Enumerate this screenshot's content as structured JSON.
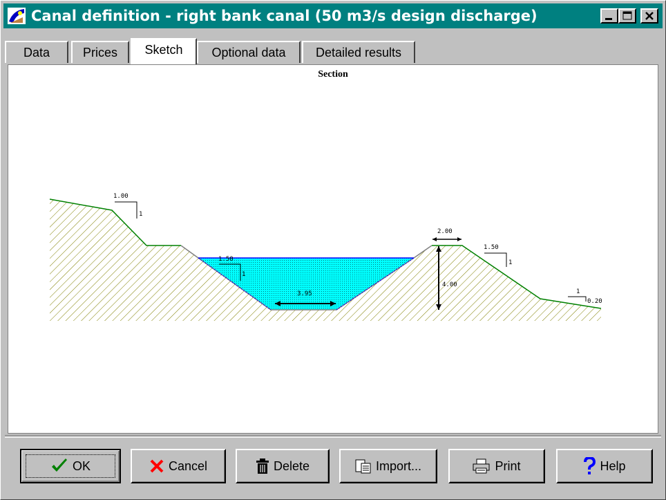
{
  "window": {
    "title": "Canal definition - right bank canal (50 m3/s design discharge)"
  },
  "tabs": [
    {
      "label": "Data"
    },
    {
      "label": "Prices"
    },
    {
      "label": "Sketch"
    },
    {
      "label": "Optional data"
    },
    {
      "label": "Detailed results"
    }
  ],
  "active_tab": "Sketch",
  "sketch": {
    "title": "Section",
    "labels": {
      "left_slope_top": "1.00",
      "left_slope_vertical": "1",
      "canal_slope_top": "1.50",
      "canal_slope_vertical": "1",
      "bottom_width": "3.95",
      "bank_top_width": "2.00",
      "canal_depth": "4.00",
      "right_slope_top": "1.50",
      "right_slope_vertical": "1",
      "far_slope_top": "1",
      "far_slope_side": "0.20"
    }
  },
  "buttons": {
    "ok": "OK",
    "cancel": "Cancel",
    "delete": "Delete",
    "import": "Import...",
    "print": "Print",
    "help": "Help"
  },
  "icons": {
    "app": "canal-app-icon",
    "minimize": "minimize-icon",
    "maximize": "maximize-icon",
    "close": "close-icon",
    "ok": "checkmark-icon",
    "cancel": "x-cancel-icon",
    "delete": "trash-icon",
    "import": "clipboard-icon",
    "print": "printer-icon",
    "help": "question-icon"
  },
  "colors": {
    "titlebar": "#008080",
    "ground_line": "#008000",
    "ground_hatch": "#808000",
    "water": "#00ffff",
    "water_surface": "#0000ff",
    "check": "#008000",
    "cancel": "#ff0000",
    "help": "#0000ff"
  }
}
